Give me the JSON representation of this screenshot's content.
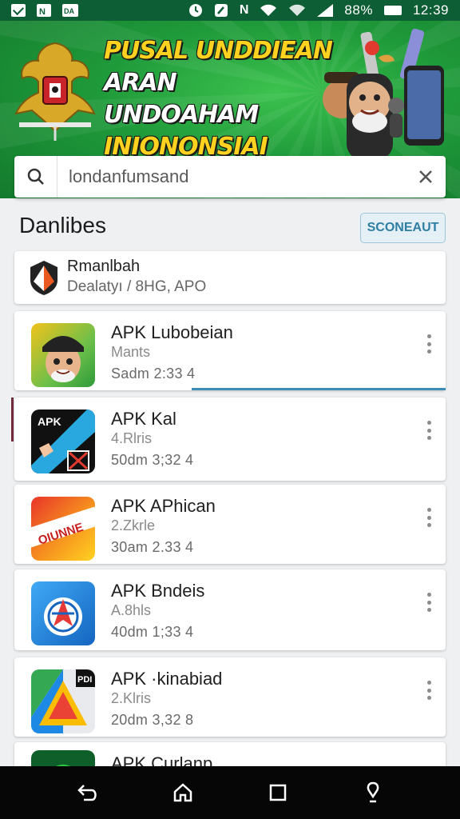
{
  "status_bar": {
    "left_icons": [
      "mail-icon",
      "n-notification-icon",
      "dc-notification-icon"
    ],
    "icon_labels": [
      "",
      "N",
      "DA"
    ],
    "right_icons": [
      "alarm-icon",
      "nfc-icon",
      "n-icon",
      "wifi-icon",
      "signal-icon",
      "battery-icon"
    ],
    "n_glyph": "N",
    "battery_percent": "88%",
    "time": "12:39"
  },
  "banner": {
    "line1": "PUSAL UNDDIEAN",
    "line2": "ARAN UNDOAHAM",
    "line3": "INIONONSIAI",
    "colors": {
      "title_yellow": "#ffd21f",
      "title_white": "#ffffff",
      "bg_green": "#1f9a3a"
    }
  },
  "search": {
    "value": "londanfumsand",
    "search_icon": "search-icon",
    "clear_icon": "close-icon"
  },
  "section": {
    "title": "Danlibes",
    "sort_label": "SCONEAUT"
  },
  "first_item": {
    "title": "Rmanlbah",
    "subtitle": "Dealatyı / 8HG, APO"
  },
  "apps": [
    {
      "name": "APK Lubobeian",
      "size": "Mants",
      "date": "Sadm 2:33 4"
    },
    {
      "name": "APK Kal",
      "size": "4.Rlris",
      "date": "50dm 3;32 4",
      "icon_text": "APK"
    },
    {
      "name": "APK APhican",
      "size": "2.Zkrle",
      "date": "30am 2.33 4",
      "icon_text": "OIUNNE"
    },
    {
      "name": "APK Bndeis",
      "size": "A.8hls",
      "date": "40dm 1;33 4"
    },
    {
      "name": "APK ·kinabiad",
      "size": "2.Klris",
      "date": "20dm 3,32 8",
      "icon_text": "PDI"
    },
    {
      "name": "APK Curlanp",
      "size": "",
      "date": ""
    }
  ],
  "nav": {
    "back": "back-icon",
    "home": "home-icon",
    "recents": "recents-icon",
    "assist": "assistant-icon"
  },
  "colors": {
    "status_bar_bg": "#0d5d35",
    "accent_blue": "#3c8db5",
    "sort_text": "#2e7fa3"
  }
}
